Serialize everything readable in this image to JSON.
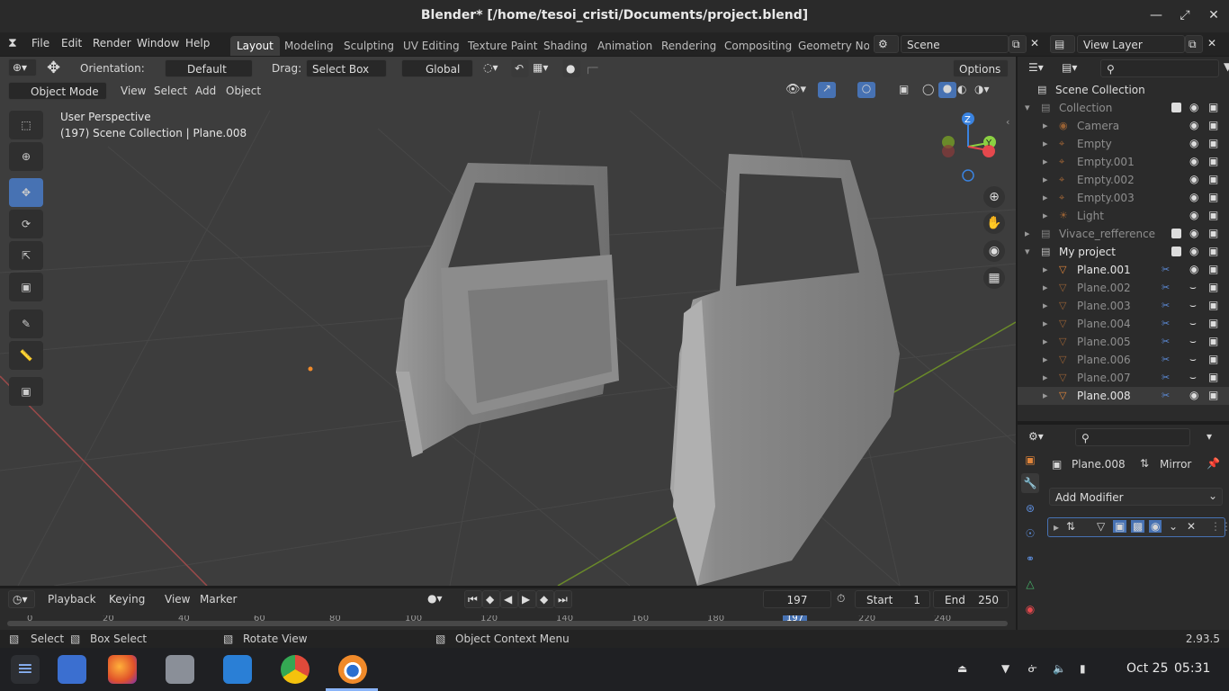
{
  "window": {
    "title": "Blender* [/home/tesoi_cristi/Documents/project.blend]"
  },
  "menubar": {
    "items": [
      "File",
      "Edit",
      "Render",
      "Window",
      "Help"
    ]
  },
  "workspaces": [
    "Layout",
    "Modeling",
    "Sculpting",
    "UV Editing",
    "Texture Paint",
    "Shading",
    "Animation",
    "Rendering",
    "Compositing",
    "Geometry Nod"
  ],
  "scene": {
    "name": "Scene",
    "view_layer": "View Layer"
  },
  "tool_header": {
    "orientation_label": "Orientation:",
    "orientation_value": "Default",
    "drag_label": "Drag:",
    "drag_value": "Select Box",
    "transform_value": "Global",
    "options_label": "Options"
  },
  "viewport_header": {
    "mode": "Object Mode",
    "menus": [
      "View",
      "Select",
      "Add",
      "Object"
    ]
  },
  "viewport": {
    "perspective": "User Perspective",
    "collection_info": "(197) Scene Collection | Plane.008"
  },
  "gizmo": {
    "z": "Z",
    "y": "Y"
  },
  "outliner": {
    "root": "Scene Collection",
    "rows": [
      {
        "label": "Collection",
        "indent": 1,
        "kind": "collection",
        "dim": true
      },
      {
        "label": "Camera",
        "indent": 2,
        "kind": "camera",
        "dim": true
      },
      {
        "label": "Empty",
        "indent": 2,
        "kind": "empty",
        "dim": true
      },
      {
        "label": "Empty.001",
        "indent": 2,
        "kind": "empty",
        "dim": true
      },
      {
        "label": "Empty.002",
        "indent": 2,
        "kind": "empty",
        "dim": true
      },
      {
        "label": "Empty.003",
        "indent": 2,
        "kind": "empty",
        "dim": true
      },
      {
        "label": "Light",
        "indent": 2,
        "kind": "light",
        "dim": true
      },
      {
        "label": "Vivace_refference",
        "indent": 1,
        "kind": "collection",
        "dim": true
      },
      {
        "label": "My project",
        "indent": 1,
        "kind": "collection",
        "dim": false
      },
      {
        "label": "Plane.001",
        "indent": 2,
        "kind": "mesh",
        "dim": false
      },
      {
        "label": "Plane.002",
        "indent": 2,
        "kind": "mesh",
        "dim": true
      },
      {
        "label": "Plane.003",
        "indent": 2,
        "kind": "mesh",
        "dim": true
      },
      {
        "label": "Plane.004",
        "indent": 2,
        "kind": "mesh",
        "dim": true
      },
      {
        "label": "Plane.005",
        "indent": 2,
        "kind": "mesh",
        "dim": true
      },
      {
        "label": "Plane.006",
        "indent": 2,
        "kind": "mesh",
        "dim": true
      },
      {
        "label": "Plane.007",
        "indent": 2,
        "kind": "mesh",
        "dim": true
      },
      {
        "label": "Plane.008",
        "indent": 2,
        "kind": "mesh",
        "dim": false
      }
    ]
  },
  "properties": {
    "object_name": "Plane.008",
    "modifier_name": "Mirror",
    "add_modifier_label": "Add Modifier"
  },
  "timeline": {
    "menus": [
      "Playback",
      "Keying",
      "View",
      "Marker"
    ],
    "current_frame": "197",
    "start_label": "Start",
    "start_value": "1",
    "end_label": "End",
    "end_value": "250",
    "ruler_ticks": [
      "0",
      "20",
      "40",
      "60",
      "80",
      "100",
      "120",
      "140",
      "160",
      "180",
      "197",
      "220",
      "240"
    ]
  },
  "statusbar": {
    "select": "Select",
    "box_select": "Box Select",
    "rotate_view": "Rotate View",
    "context_menu": "Object Context Menu",
    "version": "2.93.5"
  },
  "taskbar": {
    "date": "Oct 25",
    "time": "05:31"
  },
  "colors": {
    "accent": "#4772b3",
    "mesh_icon": "#e0853b",
    "x_axis": "#e5484d",
    "y_axis": "#8bd142",
    "z_axis": "#3a83e0"
  }
}
